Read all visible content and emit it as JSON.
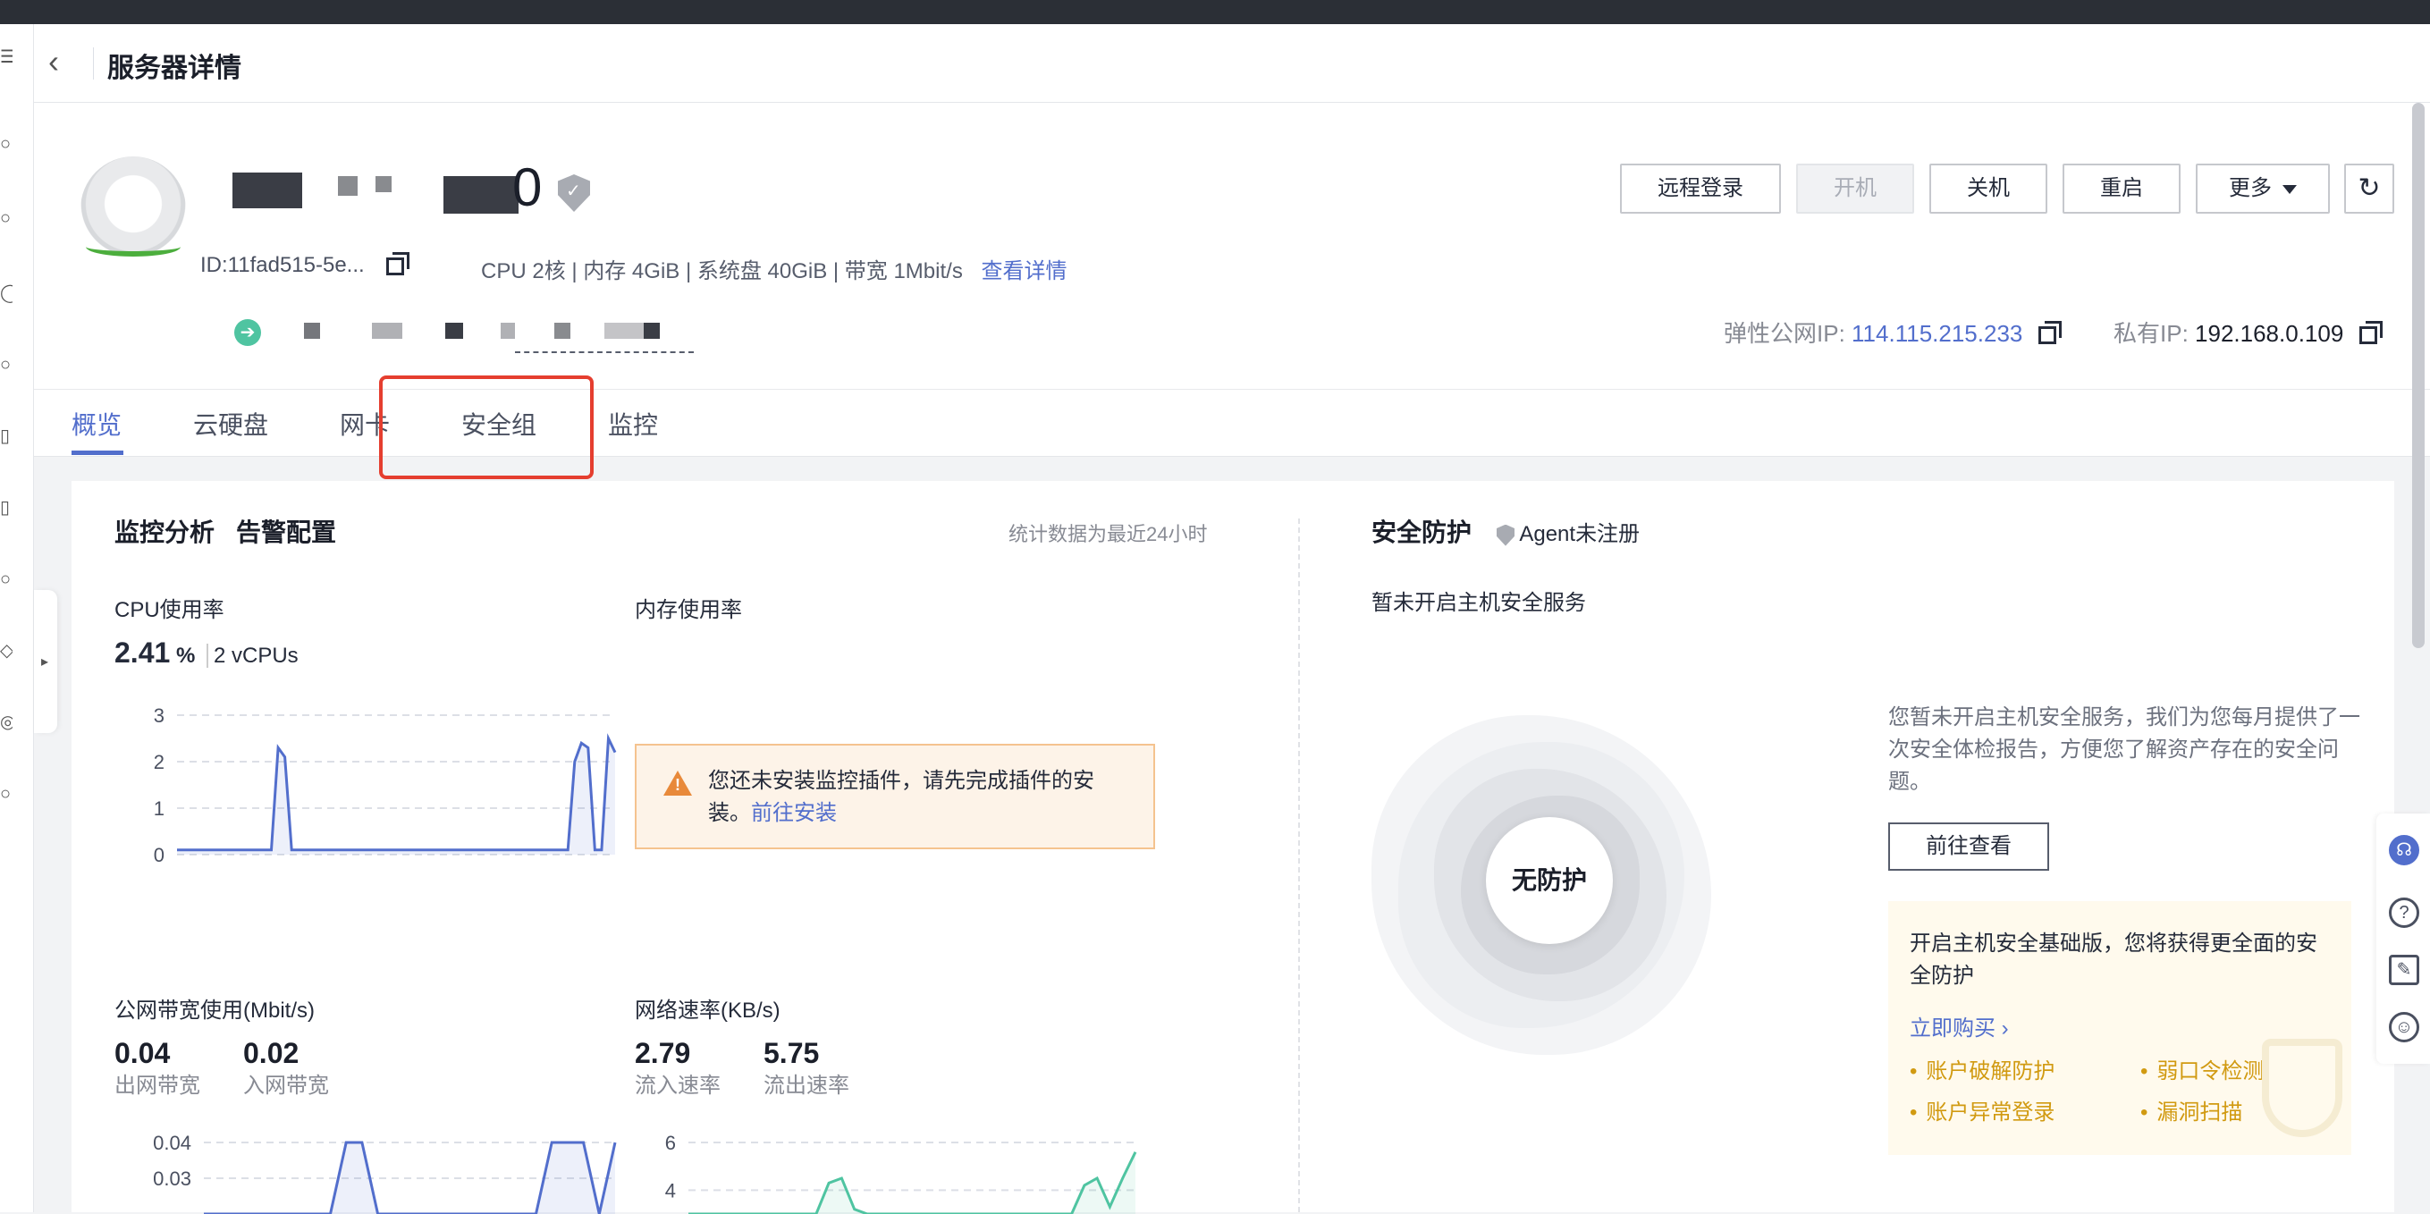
{
  "header": {
    "title": "服务器详情"
  },
  "server": {
    "name_suffix": "0",
    "id": "ID:11fad515-5e...",
    "specs": "CPU 2核 | 内存 4GiB | 系统盘 40GiB | 带宽 1Mbit/s",
    "specs_link": "查看详情"
  },
  "actions": {
    "remote_login": "远程登录",
    "start": "开机",
    "shutdown": "关机",
    "restart": "重启",
    "more": "更多"
  },
  "ip": {
    "public_label": "弹性公网IP:",
    "public_value": "114.115.215.233",
    "private_label": "私有IP:",
    "private_value": "192.168.0.109"
  },
  "tabs": [
    "概览",
    "云硬盘",
    "网卡",
    "安全组",
    "监控"
  ],
  "monitor": {
    "title": "监控分析",
    "alert_link": "告警配置",
    "stat_note": "统计数据为最近24小时",
    "cpu": {
      "label": "CPU使用率",
      "value": "2.41",
      "unit": "%",
      "vcpus": "2 vCPUs"
    },
    "mem": {
      "label": "内存使用率"
    },
    "warning": {
      "text": "您还未安装监控插件，请先完成插件的安装。",
      "link": "前往安装"
    },
    "bandwidth": {
      "label": "公网带宽使用(Mbit/s)",
      "out_value": "0.04",
      "out_label": "出网带宽",
      "in_value": "0.02",
      "in_label": "入网带宽"
    },
    "network": {
      "label": "网络速率(KB/s)",
      "in_value": "2.79",
      "in_label": "流入速率",
      "out_value": "5.75",
      "out_label": "流出速率"
    }
  },
  "security": {
    "title": "安全防护",
    "agent_status": "Agent未注册",
    "not_enabled": "暂未开启主机安全服务",
    "state": "无防护",
    "desc": "您暂未开启主机安全服务，我们为您每月提供了一次安全体检报告，方便您了解资产存在的安全问题。",
    "view_button": "前往查看",
    "promo_text": "开启主机安全基础版，您将获得更全面的安全防护",
    "buy_link": "立即购买",
    "features": [
      "账户破解防护",
      "弱口令检测",
      "账户异常登录",
      "漏洞扫描"
    ]
  },
  "chart_data": [
    {
      "type": "line",
      "title": "CPU使用率",
      "yticks": [
        "3",
        "2",
        "1",
        "0"
      ],
      "ylim": [
        0,
        3
      ],
      "series": [
        {
          "values": [
            0.1,
            0.1,
            0.1,
            0.1,
            0.1,
            0.1,
            0.1,
            0.1,
            0.1,
            0.1,
            0.1,
            0.1,
            0.1,
            0.1,
            0.1,
            2.3,
            2.1,
            0.1,
            0.1,
            0.1,
            0.1,
            0.1,
            0.1,
            0.1,
            0.1,
            0.1,
            0.1,
            0.1,
            0.1,
            0.1,
            0.1,
            0.1,
            0.1,
            0.1,
            0.1,
            0.1,
            0.1,
            0.1,
            0.1,
            0.1,
            0.1,
            0.1,
            0.1,
            0.1,
            0.1,
            0.1,
            0.1,
            0.1,
            0.1,
            0.1,
            0.1,
            0.1,
            0.1,
            0.1,
            0.1,
            0.1,
            0.1,
            0.1,
            0.1,
            2.0,
            2.4,
            2.3,
            0.1,
            0.1,
            2.5,
            2.2
          ]
        }
      ]
    },
    {
      "type": "line",
      "title": "公网带宽使用(Mbit/s)",
      "yticks": [
        "0.04",
        "0.03"
      ],
      "ylim": [
        0.02,
        0.04
      ],
      "series": [
        {
          "values": [
            0.02,
            0.02,
            0.02,
            0.02,
            0.02,
            0.02,
            0.02,
            0.02,
            0.02,
            0.04,
            0.04,
            0.02,
            0.02,
            0.02,
            0.02,
            0.02,
            0.02,
            0.02,
            0.02,
            0.02,
            0.02,
            0.02,
            0.04,
            0.04,
            0.04,
            0.02,
            0.04
          ]
        }
      ]
    },
    {
      "type": "line",
      "title": "网络速率(KB/s)",
      "yticks": [
        "6",
        "4"
      ],
      "ylim": [
        3,
        6
      ],
      "series": [
        {
          "values": [
            3,
            3,
            3,
            3,
            3,
            3,
            3,
            3,
            3,
            3,
            3,
            4.3,
            4.5,
            3.2,
            3,
            3,
            3,
            3,
            3,
            3,
            3,
            3,
            3,
            3,
            3,
            3,
            3,
            3,
            3,
            3,
            3,
            4.2,
            4.5,
            3.3,
            4.5,
            5.6
          ]
        }
      ]
    }
  ]
}
